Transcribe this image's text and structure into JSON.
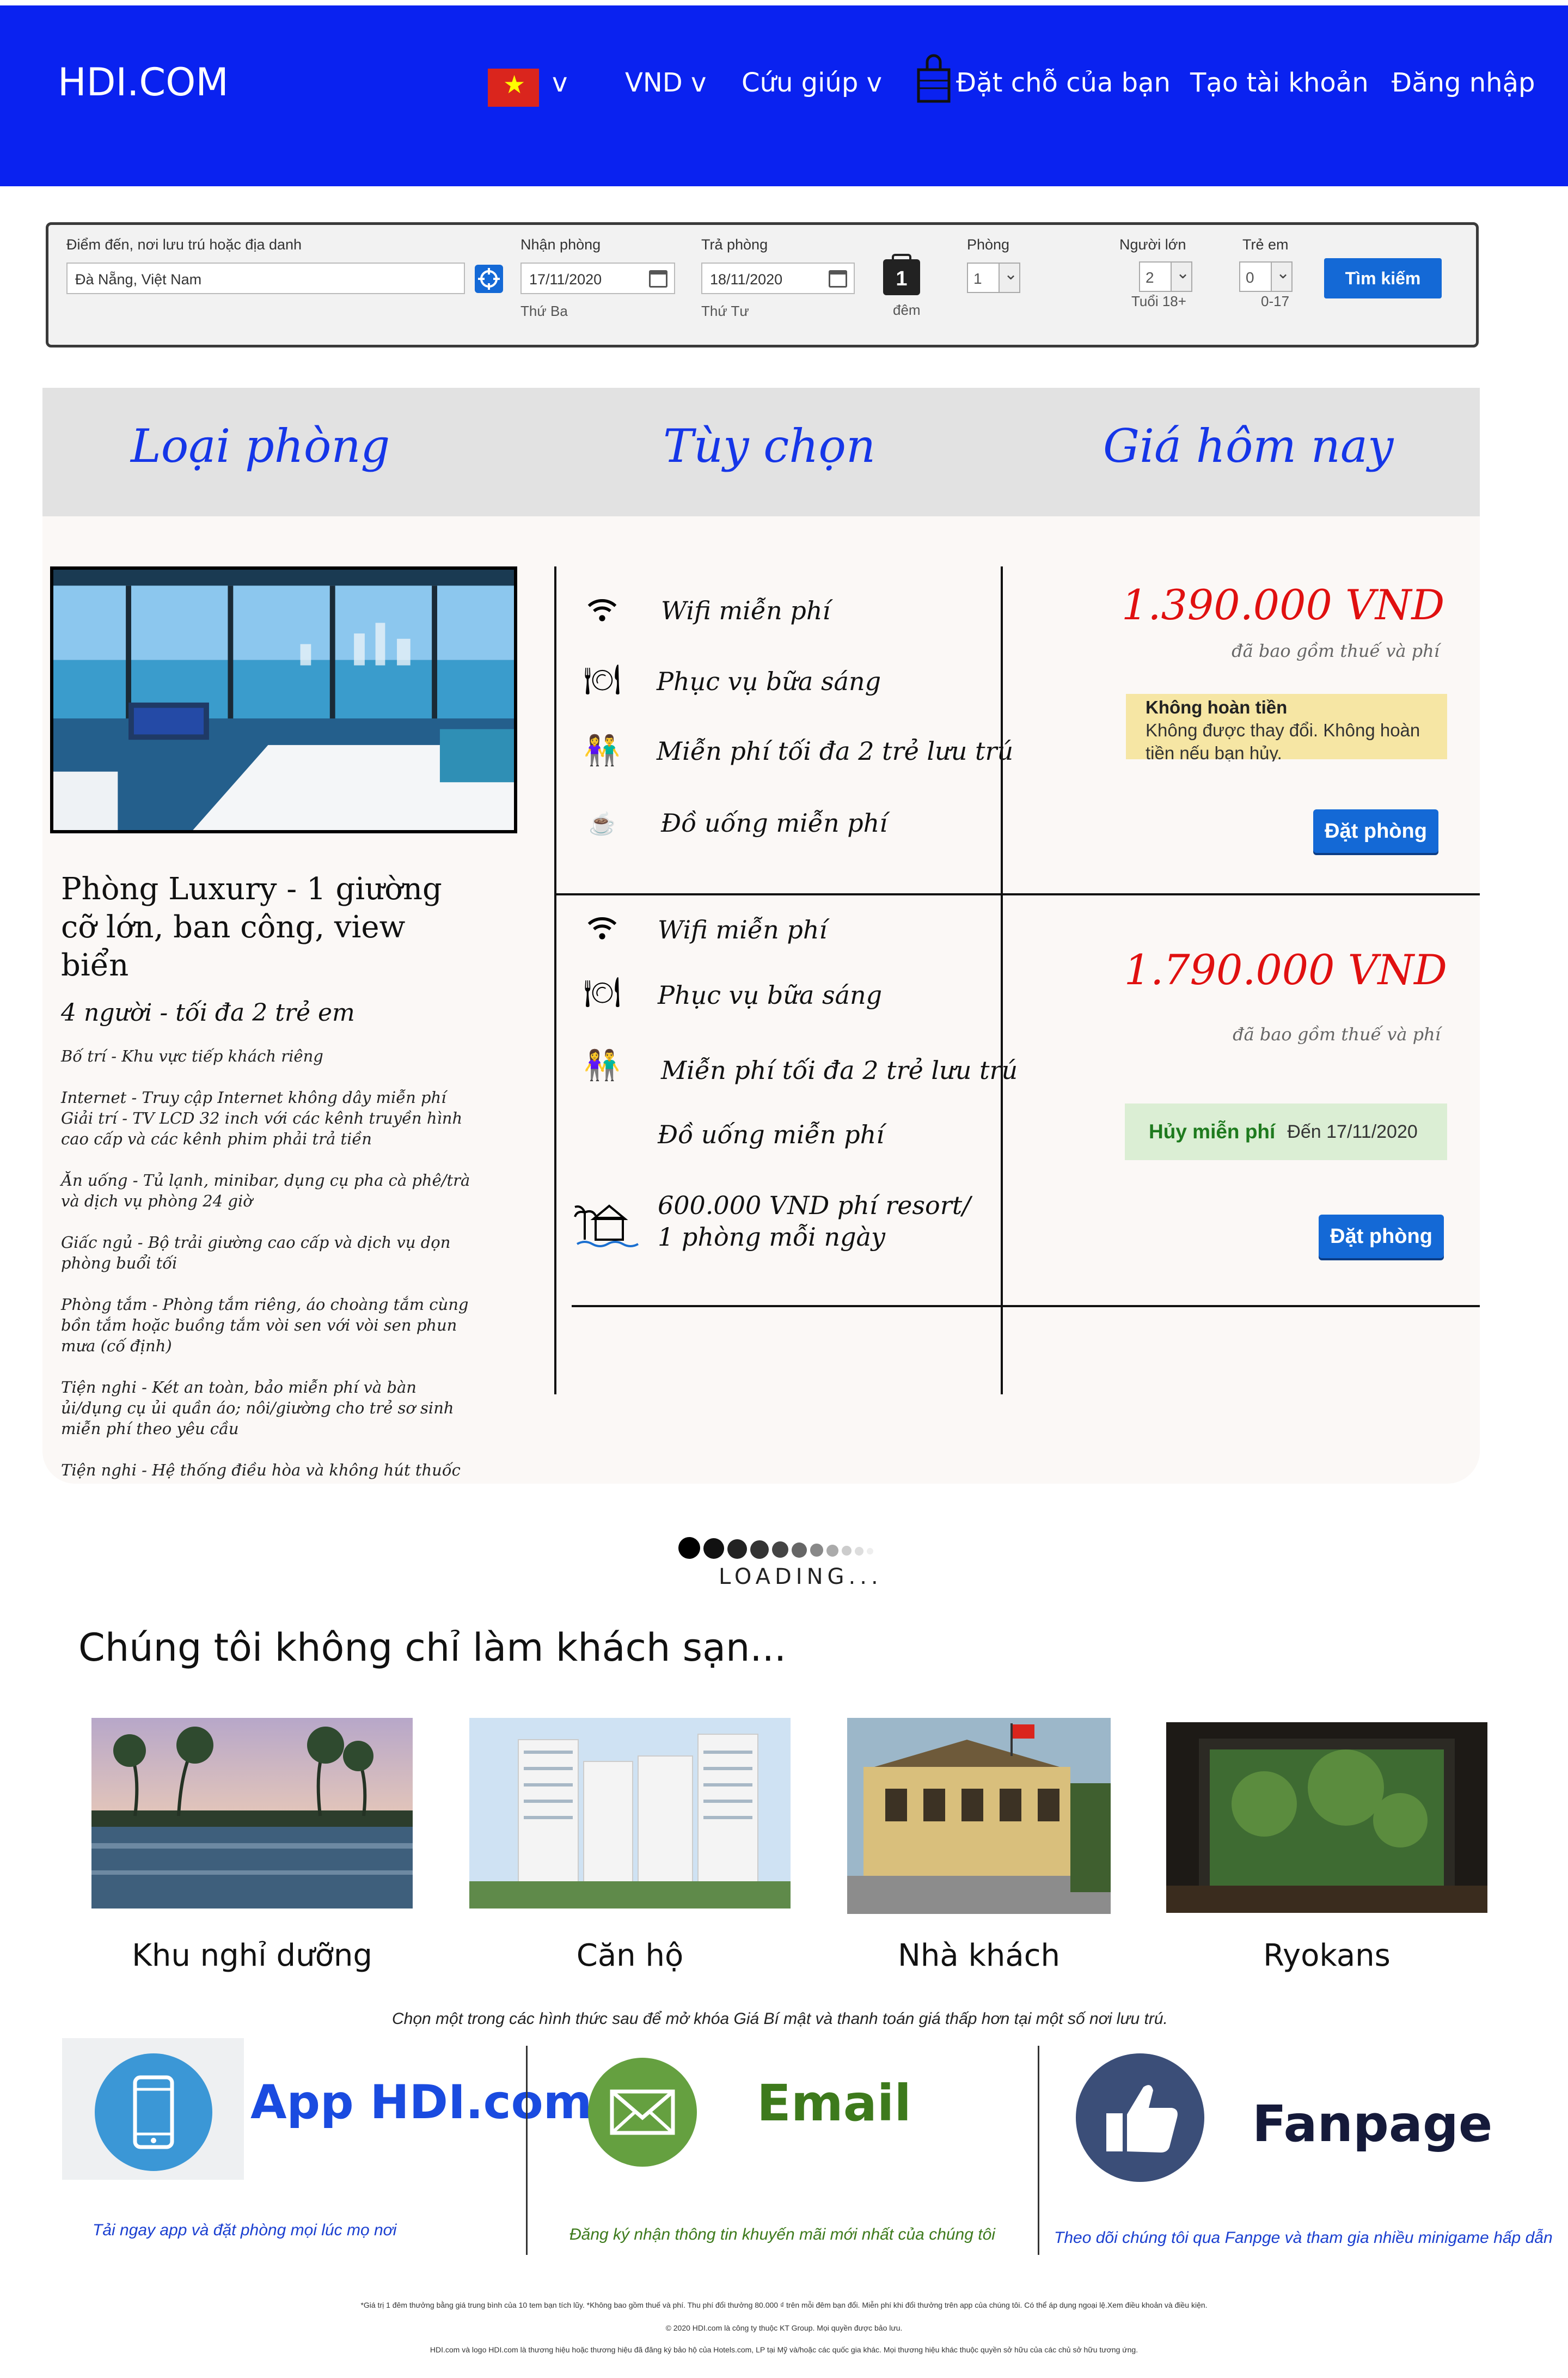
{
  "header": {
    "logo": "HDI.COM",
    "lang_label": "v",
    "currency": "VND v",
    "help": "Cứu giúp v",
    "bookings": "Đặt chỗ của bạn",
    "register": "Tạo tài khoản",
    "login": "Đăng nhập"
  },
  "search": {
    "destination_label": "Điểm đến, nơi lưu trú hoặc địa danh",
    "destination_value": "Đà Nẵng, Việt Nam",
    "checkin_label": "Nhận phòng",
    "checkin_value": "17/11/2020",
    "checkin_day": "Thứ Ba",
    "checkout_label": "Trả phòng",
    "checkout_value": "18/11/2020",
    "checkout_day": "Thứ Tư",
    "nights_value": "1",
    "nights_label": "đêm",
    "rooms_label": "Phòng",
    "rooms_value": "1",
    "adults_label": "Người lớn",
    "adults_value": "2",
    "adults_sub": "Tuổi 18+",
    "children_label": "Trẻ em",
    "children_value": "0",
    "children_sub": "0-17",
    "button": "Tìm kiếm"
  },
  "table": {
    "col_room": "Loại phòng",
    "col_options": "Tùy chọn",
    "col_price": "Giá hôm nay"
  },
  "room": {
    "title": "Phòng Luxury - 1 giường cỡ lớn, ban công, view biển",
    "occupancy": "4 người - tối đa 2 trẻ em",
    "desc": [
      "Bố trí - Khu vực tiếp khách riêng",
      "Internet - Truy cập Internet không dây miễn phí Giải trí - TV LCD 32 inch với các kênh truyền hình cao cấp và các kênh phim phải trả tiền",
      "Ăn uống - Tủ lạnh, minibar, dụng cụ pha cà phê/trà và dịch vụ phòng 24 giờ",
      "Giấc ngủ - Bộ trải giường cao cấp và dịch vụ dọn phòng buổi tối",
      "Phòng tắm - Phòng tắm riêng, áo choàng tắm cùng bồn tắm hoặc buồng tắm vòi sen với vòi sen phun mưa (cố định)",
      "Tiện nghi - Két an toàn, bảo miễn phí và bàn ủi/dụng cụ ủi quần áo; nôi/giường cho trẻ sơ sinh miễn phí theo yêu cầu",
      "Tiện nghi - Hệ thống điều hòa và không hút thuốc"
    ]
  },
  "options": [
    {
      "amenities": [
        "Wifi miễn phí",
        "Phục vụ bữa sáng",
        "Miễn phí tối đa 2 trẻ lưu trú",
        "Đồ uống miễn phí"
      ],
      "price": "1.390.000 VND",
      "tax": "đã bao gồm thuế và phí",
      "policy_title": "Không hoàn tiền",
      "policy_text": "Không được thay đổi. Không hoàn tiền nếu bạn hủy.",
      "button": "Đặt phòng"
    },
    {
      "amenities": [
        "Wifi miễn phí",
        "Phục vụ bữa sáng",
        "Miễn phí tối đa 2 trẻ lưu trú",
        "Đồ uống miễn phí"
      ],
      "resort_fee_1": "600.000 VND phí resort/",
      "resort_fee_2": "1 phòng mỗi ngày",
      "price": "1.790.000 VND",
      "tax": "đã bao gồm thuế và phí",
      "policy_title": "Hủy miễn phí",
      "policy_text": "Đến 17/11/2020",
      "button": "Đặt phòng"
    }
  ],
  "loading_text": "LOADING...",
  "section_title": "Chúng tôi không chỉ làm khách sạn...",
  "categories": [
    "Khu nghỉ dưỡng",
    "Căn hộ",
    "Nhà khách",
    "Ryokans"
  ],
  "promo": {
    "choose_text": "Chọn một trong các hình thức sau để mở khóa Giá Bí mật và thanh toán giá thấp hơn tại một số nơi lưu trú.",
    "app_title": "App HDI.com",
    "app_sub": "Tải ngay app và đặt phòng mọi lúc mọ nơi",
    "email_title": "Email",
    "email_sub": "Đăng ký nhận thông tin khuyến mãi mới nhất của chúng tôi",
    "fb_title": "Fanpage",
    "fb_sub": "Theo dõi chúng tôi qua Fanpge và tham gia nhiều minigame hấp dẫn"
  },
  "footer": {
    "line1": "*Giá trị 1 đêm thưởng bằng giá trung bình của 10 tem bạn tích lũy. *Không bao gồm thuế và phí. Thu phí đổi thưởng 80.000 ₫ trên mỗi đêm bạn đổi. Miễn phí khi đổi thưởng trên app của chúng tôi. Có thể áp dụng ngoại lệ.Xem điều khoản và điều kiện.",
    "line2": "© 2020 HDI.com là công ty thuộc KT Group. Mọi quyền được bảo lưu.",
    "line3": "HDI.com và logo HDI.com là thương hiệu hoặc thương hiệu đã đăng ký bảo hộ của Hotels.com, LP tại Mỹ và/hoặc các quốc gia khác. Mọi thương hiệu khác thuộc quyền sở hữu của các chủ sở hữu tương ứng."
  },
  "colors": {
    "header_bg": "#0a22f0",
    "accent_blue": "#1469d6",
    "price_red": "#e01010",
    "heading_blue": "#1536e8"
  }
}
